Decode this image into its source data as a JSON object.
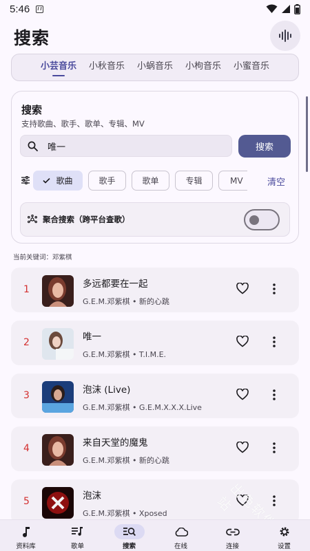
{
  "status_bar": {
    "time": "5:46"
  },
  "header": {
    "title": "搜索",
    "voice_icon": "voice-wave-icon"
  },
  "source_tabs": [
    {
      "label": "小芸音乐",
      "active": true
    },
    {
      "label": "小秋音乐",
      "active": false
    },
    {
      "label": "小蜗音乐",
      "active": false
    },
    {
      "label": "小枸音乐",
      "active": false
    },
    {
      "label": "小蜜音乐",
      "active": false
    }
  ],
  "search_card": {
    "title": "搜索",
    "subtitle": "支持歌曲、歌手、歌单、专辑、MV",
    "input_value": "唯一",
    "search_button": "搜索",
    "filters": [
      {
        "label": "歌曲",
        "selected": true
      },
      {
        "label": "歌手",
        "selected": false
      },
      {
        "label": "歌单",
        "selected": false
      },
      {
        "label": "专辑",
        "selected": false
      },
      {
        "label": "MV",
        "selected": false
      }
    ],
    "clear_label": "清空",
    "aggregate_label": "聚合搜索（跨平台查歌）",
    "aggregate_enabled": false
  },
  "keyword_label": "当前关键词：邓紫棋",
  "songs": [
    {
      "rank": "1",
      "title": "多远都要在一起",
      "meta": "G.E.M.邓紫棋 • 新的心跳"
    },
    {
      "rank": "2",
      "title": "唯一",
      "meta": "G.E.M.邓紫棋 • T.I.M.E."
    },
    {
      "rank": "3",
      "title": "泡沫 (Live)",
      "meta": "G.E.M.邓紫棋 • G.E.M.X.X.X.Live"
    },
    {
      "rank": "4",
      "title": "来自天堂的魔鬼",
      "meta": "G.E.M.邓紫棋 • 新的心跳"
    },
    {
      "rank": "5",
      "title": "泡沫",
      "meta": "G.E.M.邓紫棋 • Xposed"
    }
  ],
  "watermark": "出色软件站",
  "colors": {
    "accent": "#535a92",
    "rank": "#d32f2f",
    "background": "#fcf8ff"
  },
  "bottom_nav": [
    {
      "label": "资料库",
      "icon": "music-note-icon",
      "active": false
    },
    {
      "label": "歌单",
      "icon": "playlist-icon",
      "active": false
    },
    {
      "label": "搜索",
      "icon": "search-list-icon",
      "active": true
    },
    {
      "label": "在线",
      "icon": "cloud-icon",
      "active": false
    },
    {
      "label": "连接",
      "icon": "link-icon",
      "active": false
    },
    {
      "label": "设置",
      "icon": "gear-icon",
      "active": false
    }
  ]
}
